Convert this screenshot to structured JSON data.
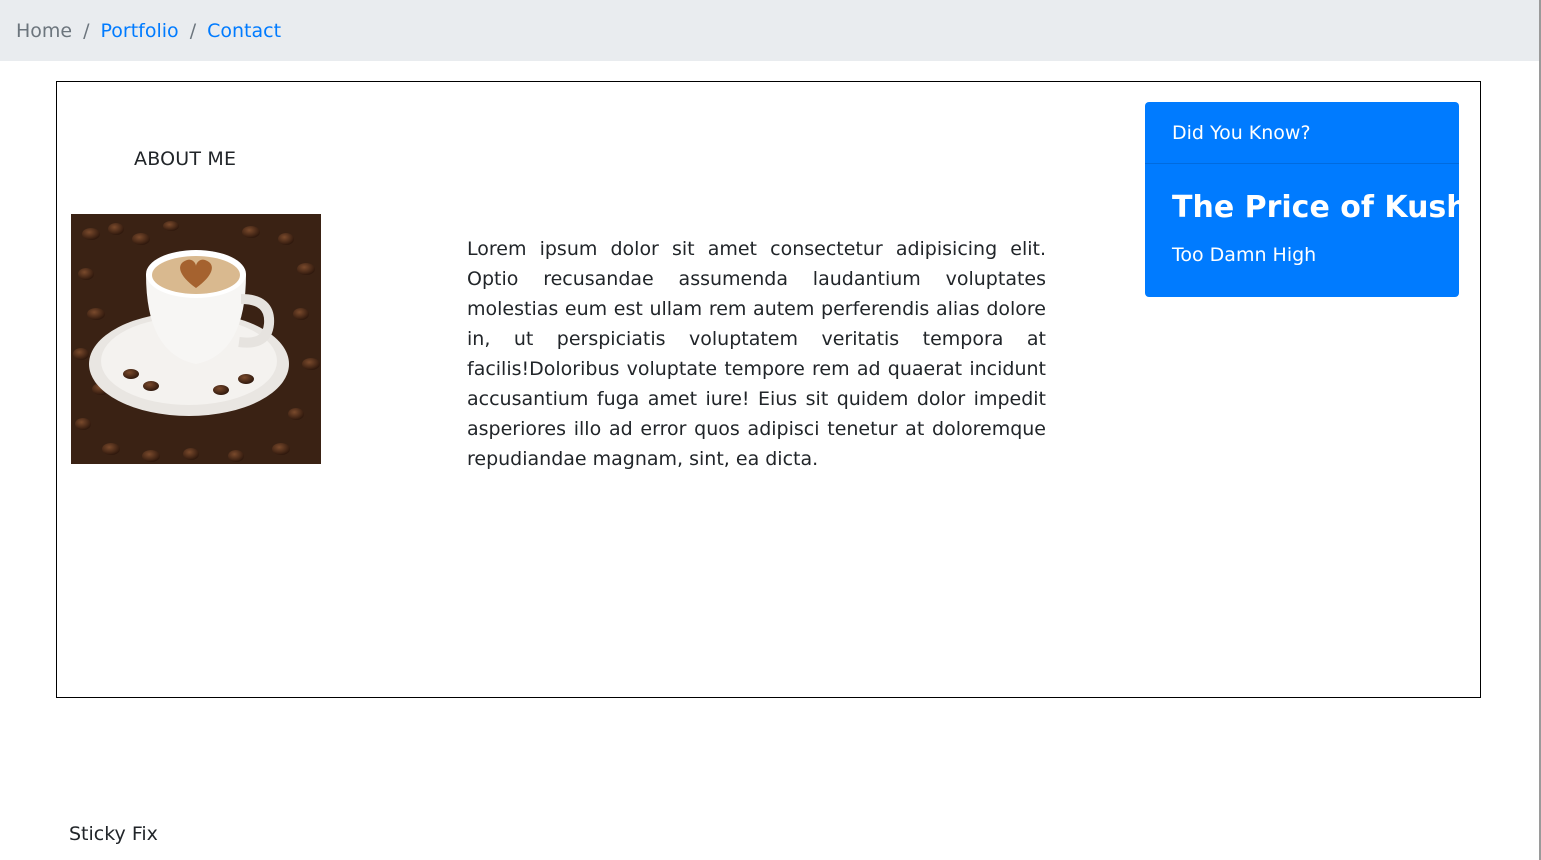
{
  "breadcrumb": {
    "items": [
      {
        "label": "Home",
        "active": true
      },
      {
        "label": "Portfolio",
        "active": false
      },
      {
        "label": "Contact",
        "active": false
      }
    ],
    "separator": "/"
  },
  "about": {
    "title": "ABOUT ME",
    "image_icon": "coffee-cup-image",
    "text": "Lorem ipsum dolor sit amet consectetur adipisicing elit. Optio recusandae assumenda laudantium voluptates molestias eum est ullam rem autem perferendis alias dolore in, ut perspiciatis voluptatem veritatis tempora at facilis!Doloribus voluptate tempore rem ad quaerat incidunt accusantium fuga amet iure! Eius sit quidem dolor impedit asperiores illo ad error quos adipisci tenetur at doloremque repudiandae magnam, sint, ea dicta."
  },
  "card": {
    "header": "Did You Know?",
    "title": "The Price of Kush",
    "text": "Too Damn High",
    "color": "#007bff"
  },
  "footer": {
    "text": "Sticky Fix"
  },
  "colors": {
    "breadcrumb_bg": "#e9ecef",
    "link": "#007bff",
    "muted": "#6c757d"
  }
}
